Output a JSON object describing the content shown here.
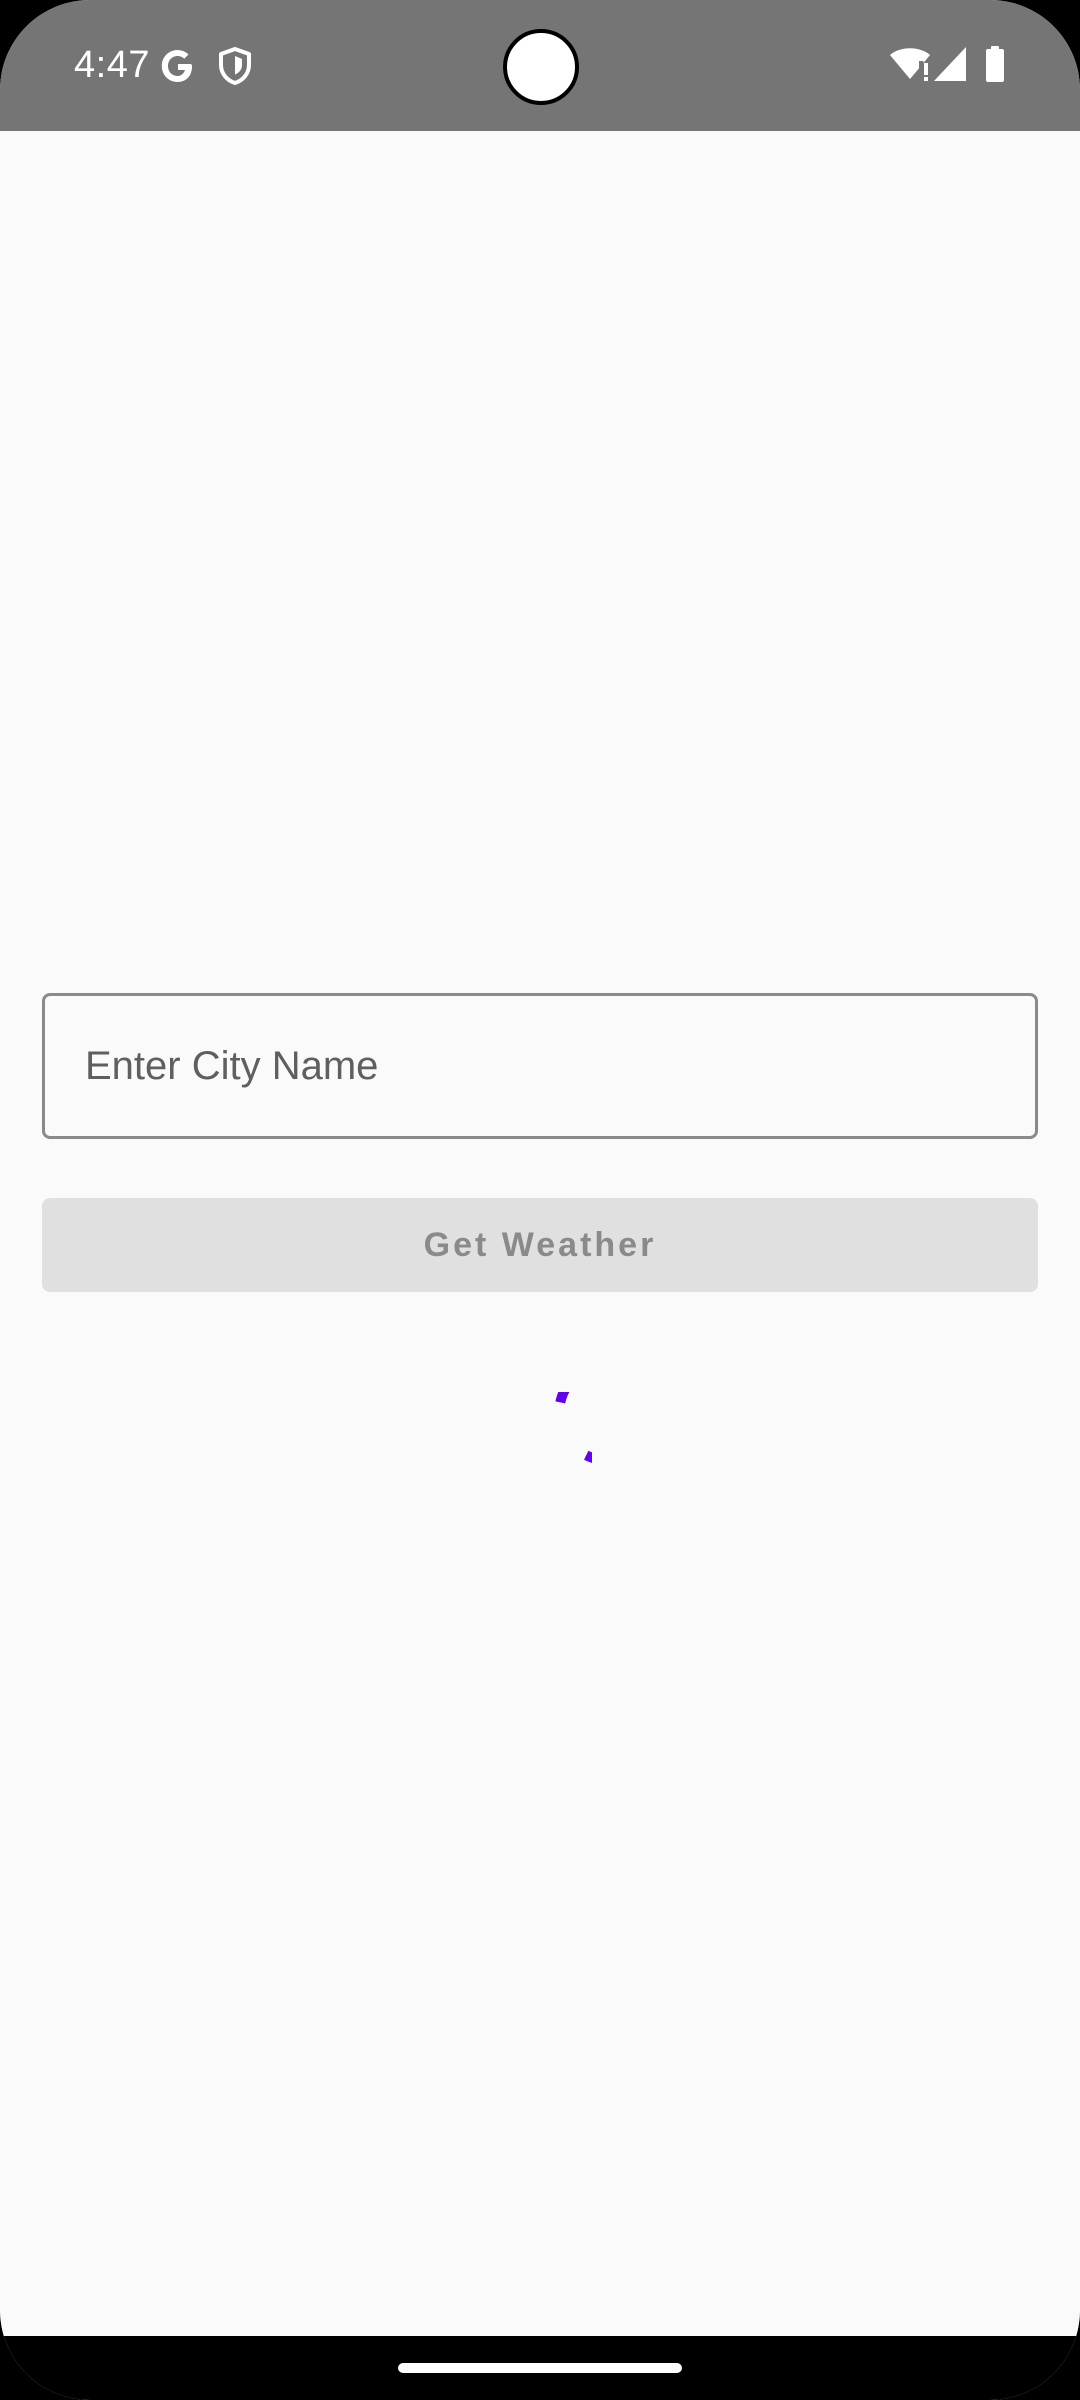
{
  "status_bar": {
    "time": "4:47",
    "background_color": "#757575",
    "left_icons": [
      "google-icon",
      "vpn-shield-icon"
    ],
    "right_icons": [
      "wifi-alert-icon",
      "cell-signal-icon",
      "battery-icon"
    ]
  },
  "form": {
    "city_input": {
      "placeholder": "Enter City Name",
      "value": ""
    },
    "submit_button": {
      "label": "Get Weather",
      "enabled": false
    }
  },
  "loading": {
    "visible": true,
    "accent_color": "#6200ee"
  }
}
